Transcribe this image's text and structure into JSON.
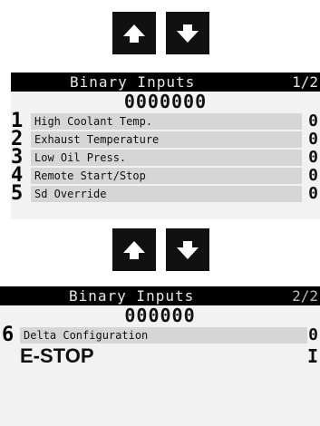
{
  "caption": "",
  "screen1": {
    "title": "Binary Inputs",
    "page": "1/2",
    "value": "0000000",
    "rows": [
      {
        "index": "1",
        "label": "High Coolant Temp.",
        "state": "0"
      },
      {
        "index": "2",
        "label": "Exhaust Temperature",
        "state": "0"
      },
      {
        "index": "3",
        "label": "Low Oil Press.",
        "state": "0"
      },
      {
        "index": "4",
        "label": "Remote Start/Stop",
        "state": "0"
      },
      {
        "index": "5",
        "label": "Sd Override",
        "state": "0"
      }
    ]
  },
  "screen2": {
    "title": "Binary Inputs",
    "page": "2/2",
    "value": "000000",
    "rows": [
      {
        "index": "6",
        "label": "Delta Configuration",
        "state": "0"
      },
      {
        "index": "",
        "label": "E-STOP",
        "state": "I"
      }
    ]
  },
  "colors": {
    "screen_bg": "#f2f2f2",
    "header_bg": "#000000",
    "row_bar": "#d6d6d6",
    "button_bg": "#111111"
  }
}
